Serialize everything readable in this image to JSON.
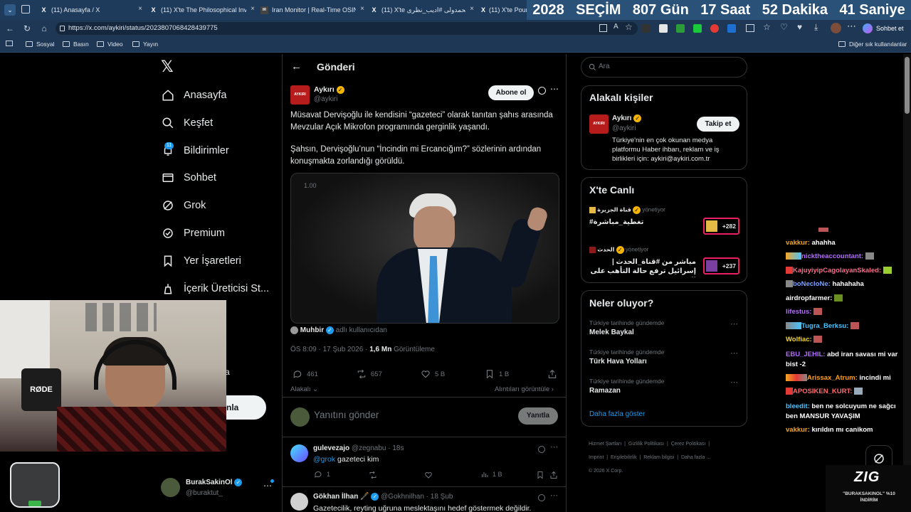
{
  "browser": {
    "tabs": [
      {
        "favicon": "X",
        "title": "(11) Anasayfa / X"
      },
      {
        "favicon": "X",
        "title": "(11) X'te The Philosophical Invest"
      },
      {
        "favicon": "IR",
        "title": "Iran Monitor | Real-Time OSINT D"
      },
      {
        "favicon": "X",
        "title": "(11) X'te محمدولی #ادیب_نظری"
      },
      {
        "favicon": "X",
        "title": "(11) X'te Pour"
      }
    ],
    "url": "https://x.com/aykiri/status/2023807068428439775",
    "bookmarks": [
      "Sosyal",
      "Basın",
      "Video",
      "Yayın"
    ],
    "other_bookmarks": "Diğer sık kullanılanlar",
    "copilot_label": "Sohbet et"
  },
  "countdown": {
    "year": "2028",
    "label": "SEÇİM",
    "days": "807 Gün",
    "hours": "17 Saat",
    "minutes": "52 Dakika",
    "seconds": "41 Saniye"
  },
  "nav": {
    "items": [
      {
        "icon": "home-icon",
        "label": "Anasayfa"
      },
      {
        "icon": "search-icon",
        "label": "Keşfet"
      },
      {
        "icon": "bell-icon",
        "label": "Bildirimler"
      },
      {
        "icon": "mail-icon",
        "label": "Sohbet"
      },
      {
        "icon": "grok-icon",
        "label": "Grok"
      },
      {
        "icon": "premium-icon",
        "label": "Premium"
      },
      {
        "icon": "bookmark-icon",
        "label": "Yer İşaretleri"
      },
      {
        "icon": "creator-icon",
        "label": "İçerik Üreticisi St..."
      }
    ],
    "notification_count": "11",
    "post_button_fragment": "nla",
    "obscured_label_fragment": "a",
    "account": {
      "name": "BurakSakinOl",
      "handle": "@buraktut_"
    }
  },
  "post": {
    "header_title": "Gönderi",
    "author_name": "Aykırı",
    "author_handle": "@aykiri",
    "avatar_text": "AYKIRI",
    "follow_label": "Abone ol",
    "paragraph1": "Müsavat Dervişoğlu ile kendisini “gazeteci” olarak tanıtan şahıs arasında Mevzular Açık Mikrofon programında gerginlik yaşandı.",
    "paragraph2": "Şahsın, Dervişoğlu’nun “İncindin mi Ercancığım?” sözlerinin ardından konuşmakta zorlandığı görüldü.",
    "video_speed": "1.00",
    "source_user": "Muhbir",
    "source_suffix": "adlı kullanıcıdan",
    "time": "ÖS 8:09 · 17 Şub 2026 ·",
    "views_count": "1,6 Mn",
    "views_label": "Görüntüleme",
    "replies": "461",
    "reposts": "657",
    "likes": "5 B",
    "bookmarks": "1 B",
    "related_label": "Alakalı",
    "quotes_label": "Alıntıları görüntüle",
    "reply_placeholder": "Yanıtını gönder",
    "reply_button": "Yanıtla"
  },
  "replies": [
    {
      "name": "gulevezajo",
      "handle": "@zegnabu · 18s",
      "mention": "@grok",
      "text": "gazeteci kim",
      "replies": "1",
      "views": "1 B"
    },
    {
      "name": "Gökhan İlhan 🖋️",
      "handle": "@Gokhnilhan · 18 Şub",
      "text": "Gazetecilik, reyting uğruna meslektaşını hedef göstermek değildir."
    }
  ],
  "sidebar": {
    "search_placeholder": "Ara",
    "related_title": "Alakalı kişiler",
    "related_person": {
      "name": "Aykırı",
      "handle": "@aykiri",
      "bio": "Türkiye'nin en çok okunan medya platformu Haber ihbarı, reklam ve iş birlikleri için: aykiri@aykiri.com.tr",
      "button": "Takip et"
    },
    "live_title": "X'te Canlı",
    "live": [
      {
        "host": "قناة الجزيرة",
        "suffix": "yönetiyor",
        "title": "#تغطية_مباشرة",
        "count": "+282"
      },
      {
        "host": "الحدث",
        "suffix": "yönetiyor",
        "title": "مباشر من #قناة_الحدث | إسرائيل ترفع حالة التأهب على الحدود مع ...",
        "count": "+237"
      }
    ],
    "trends_title": "Neler oluyor?",
    "trends": [
      {
        "category": "Türkiye tarihinde gündemde",
        "name": "Melek Baykal"
      },
      {
        "category": "Türkiye tarihinde gündemde",
        "name": "Türk Hava Yolları"
      },
      {
        "category": "Türkiye tarihinde gündemde",
        "name": "Ramazan"
      }
    ],
    "show_more": "Daha fazla göster",
    "footer_links": [
      "Hizmet Şartları",
      "Gizlilik Politikası",
      "Çerez Politikası",
      "Imprint",
      "Erişilebilirlik",
      "Reklam bilgisi",
      "Daha fazla ..."
    ],
    "copyright": "© 2026 X Corp."
  },
  "chat": [
    {
      "user": "vakkur:",
      "color": "#f5a623",
      "text": "ahahha"
    },
    {
      "user": "nicktheaccountant:",
      "color": "#b36bff",
      "text": ""
    },
    {
      "user": "KajuyiyipCagolayanSkaled:",
      "color": "#ff6b8a",
      "text": ""
    },
    {
      "user": "boNecloNe:",
      "color": "#7aa2ff",
      "text": "hahahaha"
    },
    {
      "user": "airdropfarmer:",
      "color": "#ffffff",
      "text": ""
    },
    {
      "user": "lifestus:",
      "color": "#b36bff",
      "text": ""
    },
    {
      "user": "Tugra_Berksu:",
      "color": "#49c3ff",
      "text": ""
    },
    {
      "user": "Wolfiac:",
      "color": "#f5d623",
      "text": ""
    },
    {
      "user": "EBU_JEHIL:",
      "color": "#b36bff",
      "text": "abd iran savası mi var bist -2"
    },
    {
      "user": "Arissax_Atrum:",
      "color": "#ff9f1a",
      "text": "incindi mi"
    },
    {
      "user": "APOSIKEN_KURT:",
      "color": "#ff6b6b",
      "text": ""
    },
    {
      "user": "bleedit:",
      "color": "#49c3ff",
      "text": "ben ne solcuyum ne sağcı ben MANSUR YAVAŞIM"
    },
    {
      "user": "vakkur:",
      "color": "#f5a623",
      "text": "kırıldın mı canikom"
    }
  ],
  "overlay": {
    "brand": "ZIG",
    "promo": "\"BURAKSAKINOL\" %10 İNDİRİM",
    "mic_brand": "RØDE"
  }
}
